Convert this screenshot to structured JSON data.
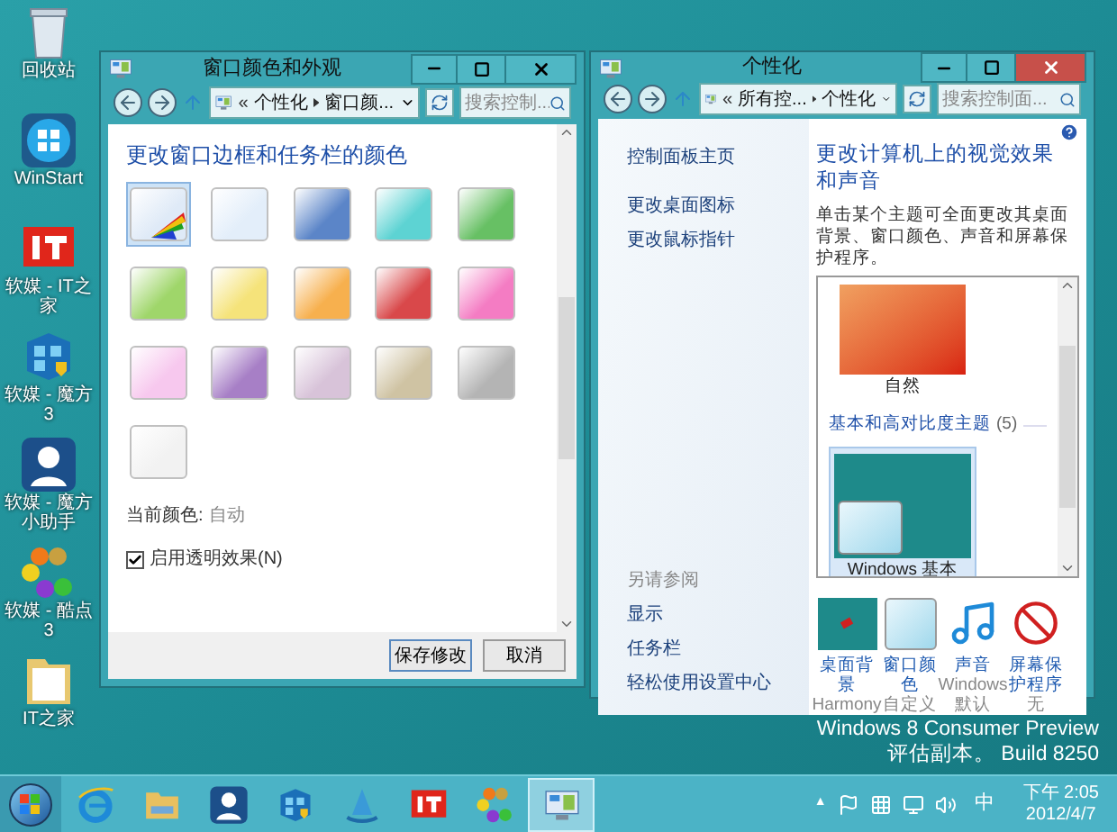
{
  "desktop_icons": [
    {
      "kind": "bin",
      "label": "回收站"
    },
    {
      "kind": "winstart",
      "label": "WinStart"
    },
    {
      "kind": "it",
      "label": "软媒 - IT之家"
    },
    {
      "kind": "cube",
      "label": "软媒 - 魔方3"
    },
    {
      "kind": "helper",
      "label": "软媒 - 魔方小助手"
    },
    {
      "kind": "hex",
      "label": "软媒 - 酷点3"
    },
    {
      "kind": "folder",
      "label": "IT之家"
    }
  ],
  "color_window": {
    "title": "窗口颜色和外观",
    "active": false,
    "breadcrumb_overflow": "«",
    "breadcrumb": [
      "个性化",
      "窗口颜..."
    ],
    "search": {
      "placeholder": "搜索控制..."
    },
    "heading": "更改窗口边框和任务栏的颜色",
    "swatches": [
      {
        "kind": "custom",
        "color": "#dfeaf7",
        "selected": true
      },
      {
        "kind": "preset",
        "color": "#e3eefa",
        "selected": false
      },
      {
        "kind": "preset",
        "color": "#5b85c8",
        "selected": false
      },
      {
        "kind": "preset",
        "color": "#5dd3d3",
        "selected": false
      },
      {
        "kind": "preset",
        "color": "#67c064",
        "selected": false
      },
      {
        "kind": "preset",
        "color": "#9fd66a",
        "selected": false
      },
      {
        "kind": "preset",
        "color": "#f5e37a",
        "selected": false
      },
      {
        "kind": "preset",
        "color": "#f7b04e",
        "selected": false
      },
      {
        "kind": "preset",
        "color": "#d9484a",
        "selected": false
      },
      {
        "kind": "preset",
        "color": "#f47cc3",
        "selected": false
      },
      {
        "kind": "preset",
        "color": "#f7c8ee",
        "selected": false
      },
      {
        "kind": "preset",
        "color": "#a77fc6",
        "selected": false
      },
      {
        "kind": "preset",
        "color": "#d8c3d9",
        "selected": false
      },
      {
        "kind": "preset",
        "color": "#cfc3a3",
        "selected": false
      },
      {
        "kind": "preset",
        "color": "#b4b4b4",
        "selected": false
      },
      {
        "kind": "preset",
        "color": "#f2f2f2",
        "selected": false
      }
    ],
    "current_color_label": "当前颜色:",
    "current_color_value": "自动",
    "transparency": {
      "label": "启用透明效果(N)",
      "checked": true
    },
    "buttons": [
      "保存修改",
      "取消"
    ]
  },
  "personalize_window": {
    "title": "个性化",
    "active": true,
    "breadcrumb_overflow": "«",
    "breadcrumb": [
      "所有控...",
      "个性化"
    ],
    "search": {
      "placeholder": "搜索控制面..."
    },
    "sidebar": {
      "links": [
        "控制面板主页",
        "更改桌面图标",
        "更改鼠标指针"
      ],
      "see_also_heading": "另请参阅",
      "see_also": [
        "显示",
        "任务栏",
        "轻松使用设置中心"
      ]
    },
    "heading": "更改计算机上的视觉效果和声音",
    "description": "单击某个主题可全面更改其桌面背景、窗口颜色、声音和屏幕保护程序。",
    "themes": [
      {
        "kind": "theme",
        "name": "自然",
        "selected": false
      },
      {
        "kind": "group",
        "label": "基本和高对比度主题",
        "count": "(5)"
      },
      {
        "kind": "theme",
        "name": "Windows 基本",
        "selected": true
      }
    ],
    "settings": [
      {
        "kind": "background",
        "label": "桌面背景",
        "value": "Harmony"
      },
      {
        "kind": "color",
        "label": "窗口颜色",
        "value": "自定义"
      },
      {
        "kind": "sound",
        "label": "声音",
        "value": "Windows 默认"
      },
      {
        "kind": "screensaver",
        "label": "屏幕保护程序",
        "value": "无"
      }
    ]
  },
  "desktop_info": [
    "Windows 8 Consumer Preview",
    "评估副本。 Build 8250"
  ],
  "taskbar": {
    "pinned": [
      {
        "kind": "ie",
        "active": false
      },
      {
        "kind": "explorer",
        "active": false
      },
      {
        "kind": "helper",
        "active": false
      },
      {
        "kind": "cube",
        "active": false
      },
      {
        "kind": "sail",
        "active": false
      },
      {
        "kind": "it",
        "active": false
      },
      {
        "kind": "hex",
        "active": false
      },
      {
        "kind": "panel",
        "active": true
      }
    ],
    "tray": {
      "overflow": "▲",
      "ime": "中",
      "time": "下午 2:05",
      "date": "2012/4/7"
    }
  }
}
